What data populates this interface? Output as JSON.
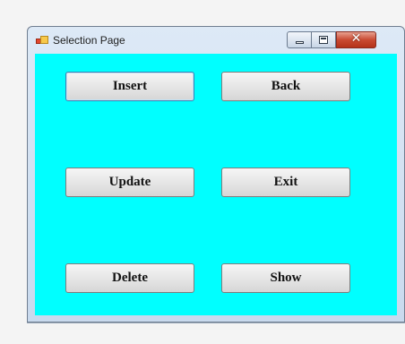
{
  "window": {
    "title": "Selection Page",
    "client_color": "#00ffff",
    "controls": {
      "minimize_icon": "minimize-icon",
      "maximize_icon": "maximize-icon",
      "close_icon": "close-icon",
      "close_glyph": "✕"
    }
  },
  "buttons": {
    "insert": "Insert",
    "back": "Back",
    "update": "Update",
    "exit": "Exit",
    "delete": "Delete",
    "show": "Show"
  }
}
